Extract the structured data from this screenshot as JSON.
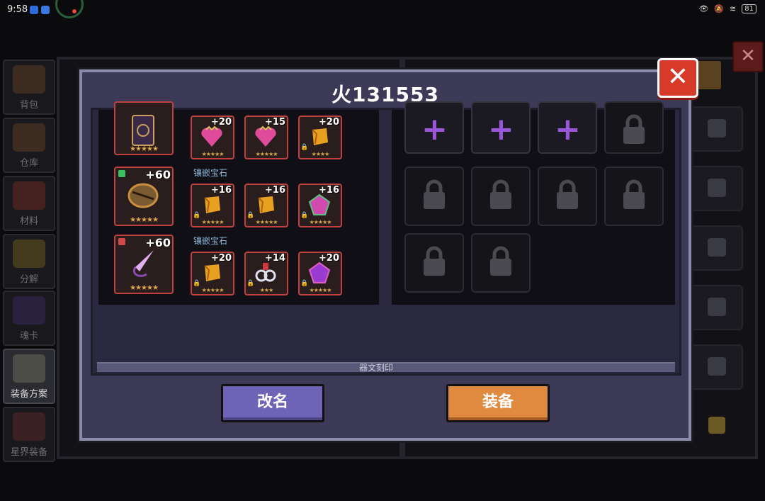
{
  "status_bar": {
    "time": "9:58",
    "battery": "81"
  },
  "sidebar": {
    "items": [
      {
        "label": "背包"
      },
      {
        "label": "仓库"
      },
      {
        "label": "材料"
      },
      {
        "label": "分解"
      },
      {
        "label": "魂卡"
      },
      {
        "label": "装备方案"
      },
      {
        "label": "星界装备"
      }
    ]
  },
  "background": {
    "right_tag": "锁"
  },
  "modal": {
    "title": "火131553",
    "items": [
      {
        "level": "",
        "stars": "★★★★★",
        "icon": "rune-card-icon"
      },
      {
        "level": "+20",
        "stars": "★★★★★",
        "icon": "heart-crown-gem-icon"
      },
      {
        "level": "+15",
        "stars": "★★★★★",
        "icon": "heart-crown-gem-icon"
      },
      {
        "level": "+20",
        "stars": "★★★★",
        "icon": "golden-scroll-icon"
      },
      {
        "level": "+60",
        "stars": "★★★★★",
        "icon": "bronze-disc-icon"
      },
      {
        "level": "+16",
        "stars": "★★★★★",
        "icon": "golden-scroll-icon"
      },
      {
        "level": "+16",
        "stars": "★★★★★",
        "icon": "golden-scroll-icon"
      },
      {
        "level": "+16",
        "stars": "★★★★★",
        "icon": "pink-jewel-icon"
      },
      {
        "level": "+60",
        "stars": "★★★★★",
        "icon": "crystal-blade-icon"
      },
      {
        "level": "+20",
        "stars": "★★★★★",
        "icon": "golden-scroll-icon"
      },
      {
        "level": "+14",
        "stars": "★★★",
        "icon": "chain-gem-icon"
      },
      {
        "level": "+20",
        "stars": "★★★★★",
        "icon": "purple-gem-icon"
      }
    ],
    "inlay_labels": [
      "镶嵌宝石",
      "镶嵌宝石"
    ],
    "bottom_strip_text": "器文刻印",
    "slots": {
      "plus_count": 3,
      "locked_count": 7,
      "plus_symbol": "+"
    },
    "buttons": {
      "rename": "改名",
      "equip": "装备"
    },
    "close_symbol": "✕"
  },
  "colors": {
    "accent_purple": "#9a56d8",
    "rename_button": "#6e63b6",
    "equip_button": "#e08a40",
    "close_red": "#d83a2a",
    "item_border": "#c04040"
  }
}
